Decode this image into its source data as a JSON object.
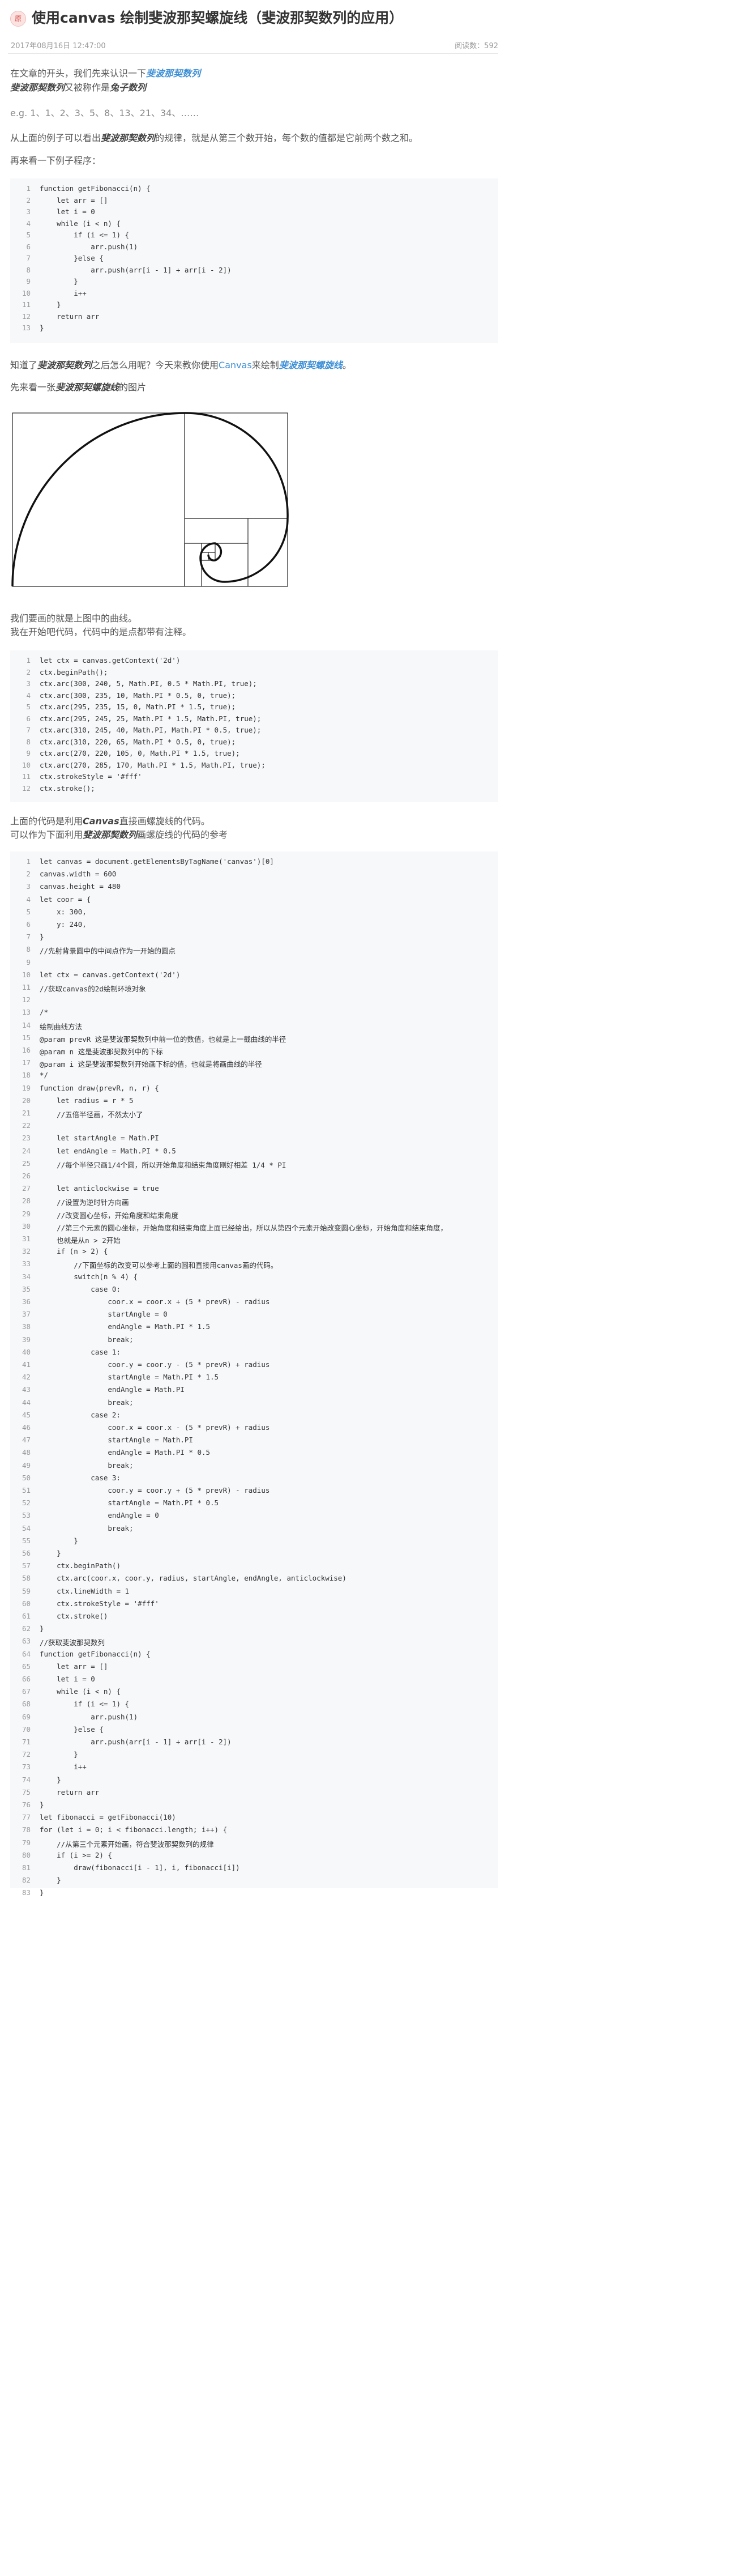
{
  "header": {
    "title": "使用canvas 绘制斐波那契螺旋线（斐波那契数列的应用）",
    "date": "2017年08月16日 12:47:00",
    "views": "阅读数：592"
  },
  "intro": {
    "p1_a": "在文章的开头，我们先来认识一下",
    "p1_link": "斐波那契数列",
    "p2_a": "斐波那契数列",
    "p2_b": "又被称作是",
    "p2_c": "兔子数列",
    "p3": "e.g. 1、1、2、3、5、8、13、21、34、……",
    "p4_a": "从上面的例子可以看出",
    "p4_b": "斐波那契数列",
    "p4_c": "的规律，就是从第三个数开始，每个数的值都是它前两个数之和。",
    "p5": "再来看一下例子程序："
  },
  "code1": [
    "function getFibonacci(n) {",
    "    let arr = []",
    "    let i = 0",
    "    while (i < n) {",
    "        if (i <= 1) {",
    "            arr.push(1)",
    "        }else {",
    "            arr.push(arr[i - 1] + arr[i - 2])",
    "        }",
    "        i++",
    "    }",
    "    return arr",
    "}"
  ],
  "middle": {
    "p6_a": "知道了",
    "p6_b": "斐波那契数列",
    "p6_c": "之后怎么用呢？今天来教你使用",
    "p6_d": "Canvas",
    "p6_e": "来绘制",
    "p6_f": "斐波那契螺旋线",
    "p6_g": "。",
    "p7_a": "先来看一张",
    "p7_b": "斐波那契螺旋线",
    "p7_c": "的图片",
    "p8": "我们要画的就是上图中的曲线。",
    "p9": "我在开始吧代码，代码中的是点都带有注释。"
  },
  "code2": [
    "let ctx = canvas.getContext('2d')",
    "ctx.beginPath();",
    "ctx.arc(300, 240, 5, Math.PI, 0.5 * Math.PI, true);",
    "ctx.arc(300, 235, 10, Math.PI * 0.5, 0, true);",
    "ctx.arc(295, 235, 15, 0, Math.PI * 1.5, true);",
    "ctx.arc(295, 245, 25, Math.PI * 1.5, Math.PI, true);",
    "ctx.arc(310, 245, 40, Math.PI, Math.PI * 0.5, true);",
    "ctx.arc(310, 220, 65, Math.PI * 0.5, 0, true);",
    "ctx.arc(270, 220, 105, 0, Math.PI * 1.5, true);",
    "ctx.arc(270, 285, 170, Math.PI * 1.5, Math.PI, true);",
    "ctx.strokeStyle = '#fff'",
    "ctx.stroke();"
  ],
  "after": {
    "p10_a": "上面的代码是利用",
    "p10_b": "Canvas",
    "p10_c": "直接画螺旋线的代码。",
    "p11_a": "可以作为下面利用",
    "p11_b": "斐波那契数列",
    "p11_c": "画螺旋线的代码的参考"
  },
  "code3": [
    "let canvas = document.getElementsByTagName('canvas')[0]",
    "canvas.width = 600",
    "canvas.height = 480",
    "let coor = {",
    "    x: 300,",
    "    y: 240,",
    "}",
    "//先射背景圆中的中间点作为一开始的圆点",
    "",
    "let ctx = canvas.getContext('2d')",
    "//获取canvas的2d绘制环境对象",
    "",
    "/*",
    "绘制曲线方法",
    "@param prevR 这是斐波那契数列中前一位的数值，也就是上一截曲线的半径",
    "@param n 这是斐波那契数列中的下标",
    "@param i 这是斐波那契数列开始画下标的值，也就是将画曲线的半径",
    "*/",
    "function draw(prevR, n, r) {",
    "    let radius = r * 5",
    "    //五倍半径画，不然太小了",
    "",
    "    let startAngle = Math.PI",
    "    let endAngle = Math.PI * 0.5",
    "    //每个半径只画1/4个圆，所以开始角度和结束角度刚好相差 1/4 * PI",
    "",
    "    let anticlockwise = true",
    "    //设置为逆时针方向画",
    "    //改变圆心坐标，开始角度和结束角度",
    "    //第三个元素的圆心坐标，开始角度和结束角度上面已经给出，所以从第四个元素开始改变圆心坐标，开始角度和结束角度，",
    "    也就是从n > 2开始",
    "    if (n > 2) {",
    "        //下面坐标的改变可以参考上面的圆和直接用canvas画的代码。",
    "        switch(n % 4) {",
    "            case 0:",
    "                coor.x = coor.x + (5 * prevR) - radius",
    "                startAngle = 0",
    "                endAngle = Math.PI * 1.5",
    "                break;",
    "            case 1:",
    "                coor.y = coor.y - (5 * prevR) + radius",
    "                startAngle = Math.PI * 1.5",
    "                endAngle = Math.PI",
    "                break;",
    "            case 2:",
    "                coor.x = coor.x - (5 * prevR) + radius",
    "                startAngle = Math.PI",
    "                endAngle = Math.PI * 0.5",
    "                break;",
    "            case 3:",
    "                coor.y = coor.y + (5 * prevR) - radius",
    "                startAngle = Math.PI * 0.5",
    "                endAngle = 0",
    "                break;",
    "        }",
    "    }",
    "    ctx.beginPath()",
    "    ctx.arc(coor.x, coor.y, radius, startAngle, endAngle, anticlockwise)",
    "    ctx.lineWidth = 1",
    "    ctx.strokeStyle = '#fff'",
    "    ctx.stroke()",
    "}",
    "//获取斐波那契数列",
    "function getFibonacci(n) {",
    "    let arr = []",
    "    let i = 0",
    "    while (i < n) {",
    "        if (i <= 1) {",
    "            arr.push(1)",
    "        }else {",
    "            arr.push(arr[i - 1] + arr[i - 2])",
    "        }",
    "        i++",
    "    }",
    "    return arr",
    "}",
    "let fibonacci = getFibonacci(10)",
    "for (let i = 0; i < fibonacci.length; i++) {",
    "    //从第三个元素开始画，符合斐波那契数列的规律",
    "    if (i >= 2) {",
    "        draw(fibonacci[i - 1], i, fibonacci[i])",
    "    }",
    "}"
  ]
}
